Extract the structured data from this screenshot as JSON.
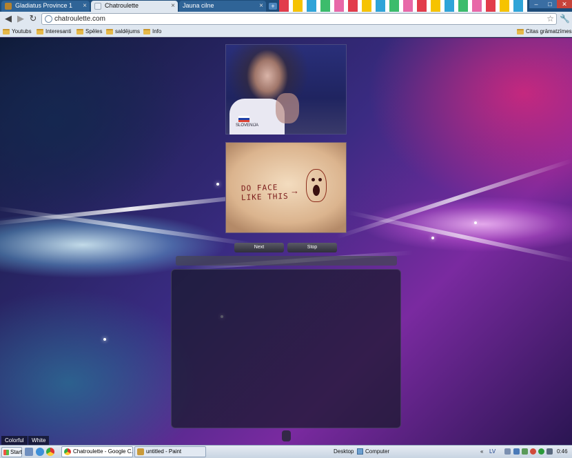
{
  "browser": {
    "tabs": [
      {
        "label": "Gladiatus Province 1",
        "active": false
      },
      {
        "label": "Chatroulette",
        "active": true
      },
      {
        "label": "Jauna cilne",
        "active": false
      }
    ],
    "tab_close_glyph": "×",
    "new_tab_glyph": "+",
    "address": "chatroulette.com",
    "bookmarks": [
      "Youtubs",
      "Interesanti",
      "Spēles",
      "saldējums",
      "Info"
    ],
    "other_bookmarks": "Citas grāmatzīmes"
  },
  "page": {
    "caption_line1": "DO FACE",
    "caption_line2": "LIKE THIS",
    "caption_arrow": "→",
    "shirt_text": "SLOVENIJA",
    "buttons": {
      "next": "Next",
      "stop": "Stop"
    },
    "themes": [
      "Colorful",
      "White"
    ]
  },
  "taskbar": {
    "start": "Start",
    "tasks": [
      "Chatroulette - Google C...",
      "untitled - Paint"
    ],
    "desktop": "Desktop",
    "computer": "Computer",
    "language": "LV",
    "clock": "0:46"
  },
  "colors": {
    "chrome_frame": "#1d4c7a",
    "toolbar": "#dfe7f0",
    "button_dark": "#2e2e3a",
    "window_close": "#c7433a"
  },
  "icons": [
    "back-icon",
    "forward-icon",
    "reload-icon",
    "globe-icon",
    "star-icon",
    "wrench-icon",
    "folder-icon",
    "windows-logo-icon"
  ]
}
